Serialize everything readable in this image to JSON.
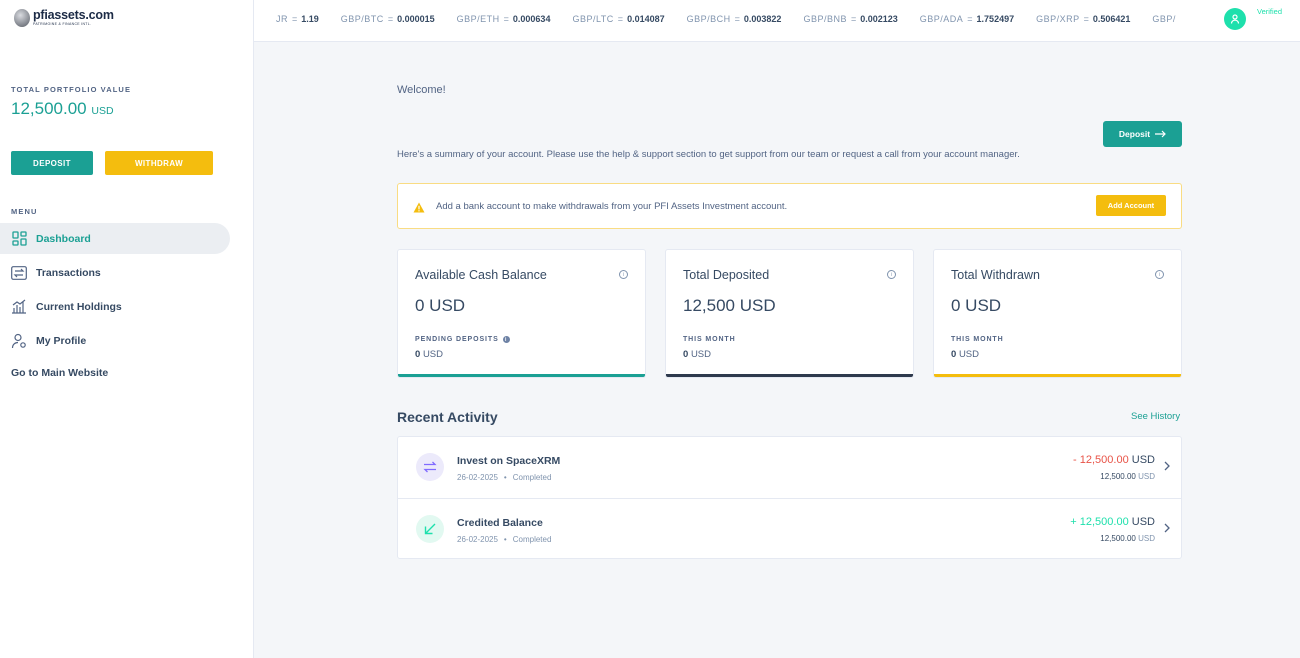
{
  "brand": {
    "name": "pfiassets.com",
    "tagline": "PATRIMOINE & FINANCE INTL."
  },
  "sidebar": {
    "portfolio_label": "TOTAL PORTFOLIO VALUE",
    "portfolio_value": "12,500.00",
    "portfolio_unit": "USD",
    "deposit_label": "DEPOSIT",
    "withdraw_label": "WITHDRAW",
    "menu_label": "MENU",
    "items": [
      {
        "label": "Dashboard",
        "icon": "dashboard-icon"
      },
      {
        "label": "Transactions",
        "icon": "transactions-icon"
      },
      {
        "label": "Current Holdings",
        "icon": "holdings-icon"
      },
      {
        "label": "My Profile",
        "icon": "profile-icon"
      }
    ],
    "main_website_label": "Go to Main Website"
  },
  "ticker": [
    {
      "pair": "JR",
      "value": "1.19"
    },
    {
      "pair": "GBP/BTC",
      "value": "0.000015"
    },
    {
      "pair": "GBP/ETH",
      "value": "0.000634"
    },
    {
      "pair": "GBP/LTC",
      "value": "0.014087"
    },
    {
      "pair": "GBP/BCH",
      "value": "0.003822"
    },
    {
      "pair": "GBP/BNB",
      "value": "0.002123"
    },
    {
      "pair": "GBP/ADA",
      "value": "1.752497"
    },
    {
      "pair": "GBP/XRP",
      "value": "0.506421"
    },
    {
      "pair": "GBP/",
      "value": ""
    }
  ],
  "user": {
    "status": "Verified"
  },
  "main": {
    "welcome": "Welcome!",
    "deposit_button": "Deposit",
    "summary": "Here's a summary of your account. Please use the help & support section to get support from our team or request a call from your account manager.",
    "alert": {
      "text": "Add a bank account to make withdrawals from your PFI Assets Investment account.",
      "button": "Add Account"
    },
    "cards": [
      {
        "title": "Available Cash Balance",
        "amount": "0 USD",
        "sub_label": "PENDING DEPOSITS",
        "sub_value": "0",
        "sub_unit": "USD",
        "bar_color": "#1ba094"
      },
      {
        "title": "Total Deposited",
        "amount": "12,500 USD",
        "sub_label": "THIS MONTH",
        "sub_value": "0",
        "sub_unit": "USD",
        "bar_color": "#2e3a4d"
      },
      {
        "title": "Total Withdrawn",
        "amount": "0 USD",
        "sub_label": "THIS MONTH",
        "sub_value": "0",
        "sub_unit": "USD",
        "bar_color": "#f4bd0e"
      }
    ],
    "recent_activity_title": "Recent Activity",
    "see_history": "See History",
    "activity": [
      {
        "title": "Invest on SpaceXRM",
        "date": "26-02-2025",
        "status": "Completed",
        "amount": "- 12,500.00",
        "currency": "USD",
        "sub_amount": "12,500.00",
        "sub_currency": "USD",
        "amount_color": "#e85347"
      },
      {
        "title": "Credited Balance",
        "date": "26-02-2025",
        "status": "Completed",
        "amount": "+ 12,500.00",
        "currency": "USD",
        "sub_amount": "12,500.00",
        "sub_currency": "USD",
        "amount_color": "#1ee0ac"
      }
    ]
  }
}
